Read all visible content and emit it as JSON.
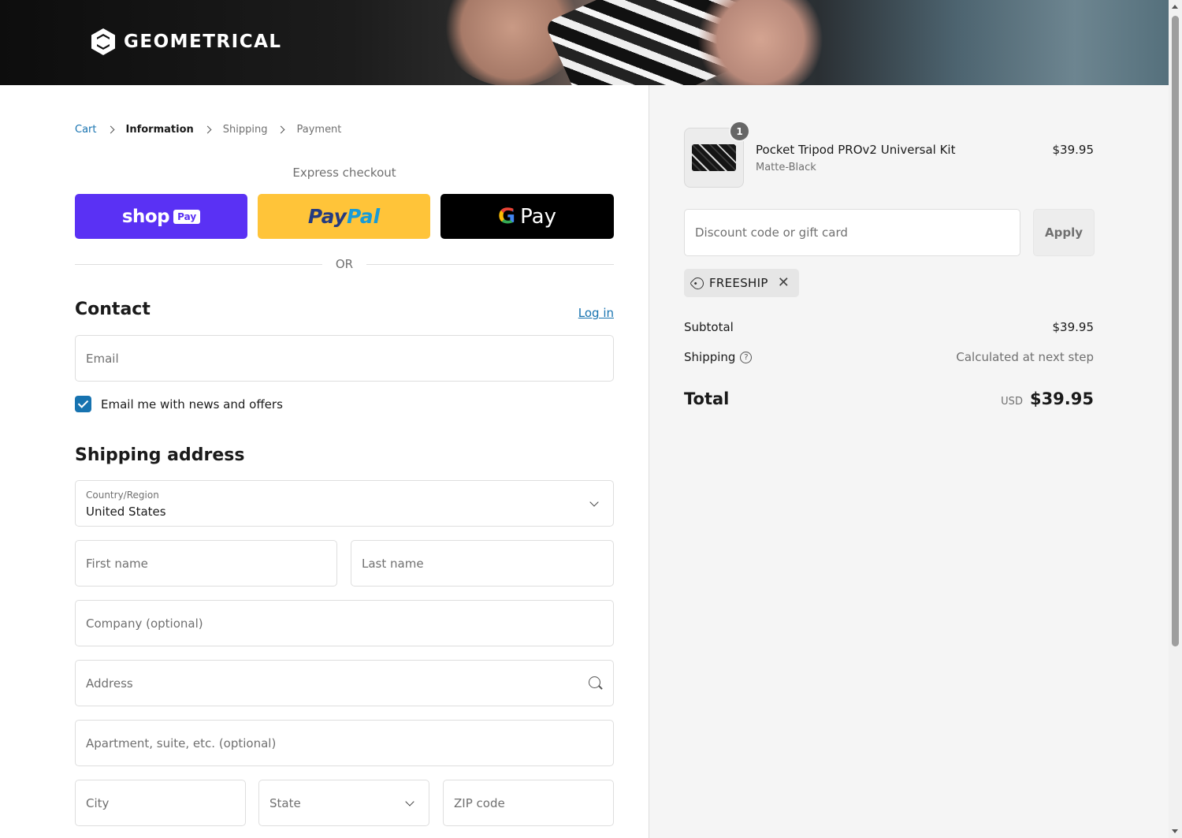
{
  "brand": {
    "name": "GEOMETRICAL"
  },
  "breadcrumb": {
    "items": [
      {
        "label": "Cart",
        "state": "link"
      },
      {
        "label": "Information",
        "state": "current"
      },
      {
        "label": "Shipping",
        "state": "upcoming"
      },
      {
        "label": "Payment",
        "state": "upcoming"
      }
    ]
  },
  "express": {
    "title": "Express checkout",
    "shop_word": "shop",
    "shop_pay_tag": "Pay",
    "paypal_part1": "Pay",
    "paypal_part2": "Pal",
    "gpay_g": "G",
    "gpay_word": "Pay",
    "or_text": "OR"
  },
  "contact": {
    "title": "Contact",
    "login_label": "Log in",
    "email_placeholder": "Email",
    "newsletter_label": "Email me with news and offers",
    "newsletter_checked": true
  },
  "shipping": {
    "title": "Shipping address",
    "country_label": "Country/Region",
    "country_value": "United States",
    "first_name_placeholder": "First name",
    "last_name_placeholder": "Last name",
    "company_placeholder": "Company (optional)",
    "address_placeholder": "Address",
    "apartment_placeholder": "Apartment, suite, etc. (optional)",
    "city_placeholder": "City",
    "state_placeholder": "State",
    "zip_placeholder": "ZIP code"
  },
  "summary": {
    "item": {
      "quantity": "1",
      "name": "Pocket Tripod PROv2 Universal Kit",
      "variant": "Matte-Black",
      "price": "$39.95"
    },
    "discount_placeholder": "Discount code or gift card",
    "apply_label": "Apply",
    "applied_code": "FREESHIP",
    "subtotal_label": "Subtotal",
    "subtotal_value": "$39.95",
    "shipping_label": "Shipping",
    "shipping_help_glyph": "?",
    "shipping_value": "Calculated at next step",
    "total_label": "Total",
    "total_currency": "USD",
    "total_value": "$39.95"
  },
  "colors": {
    "link": "#1773b0",
    "shop_pay": "#5a31f4",
    "paypal": "#ffc439",
    "gpay": "#000000",
    "summary_bg": "#f5f5f5"
  },
  "icons": {
    "logo": "geometrical-logo-icon",
    "breadcrumb_separator": "chevron-right-icon",
    "select": "chevron-down-icon",
    "address_search": "search-icon",
    "discount_tag": "tag-icon",
    "remove_code": "close-icon",
    "shipping_help": "help-circle-icon",
    "checkbox": "checkmark-icon"
  }
}
